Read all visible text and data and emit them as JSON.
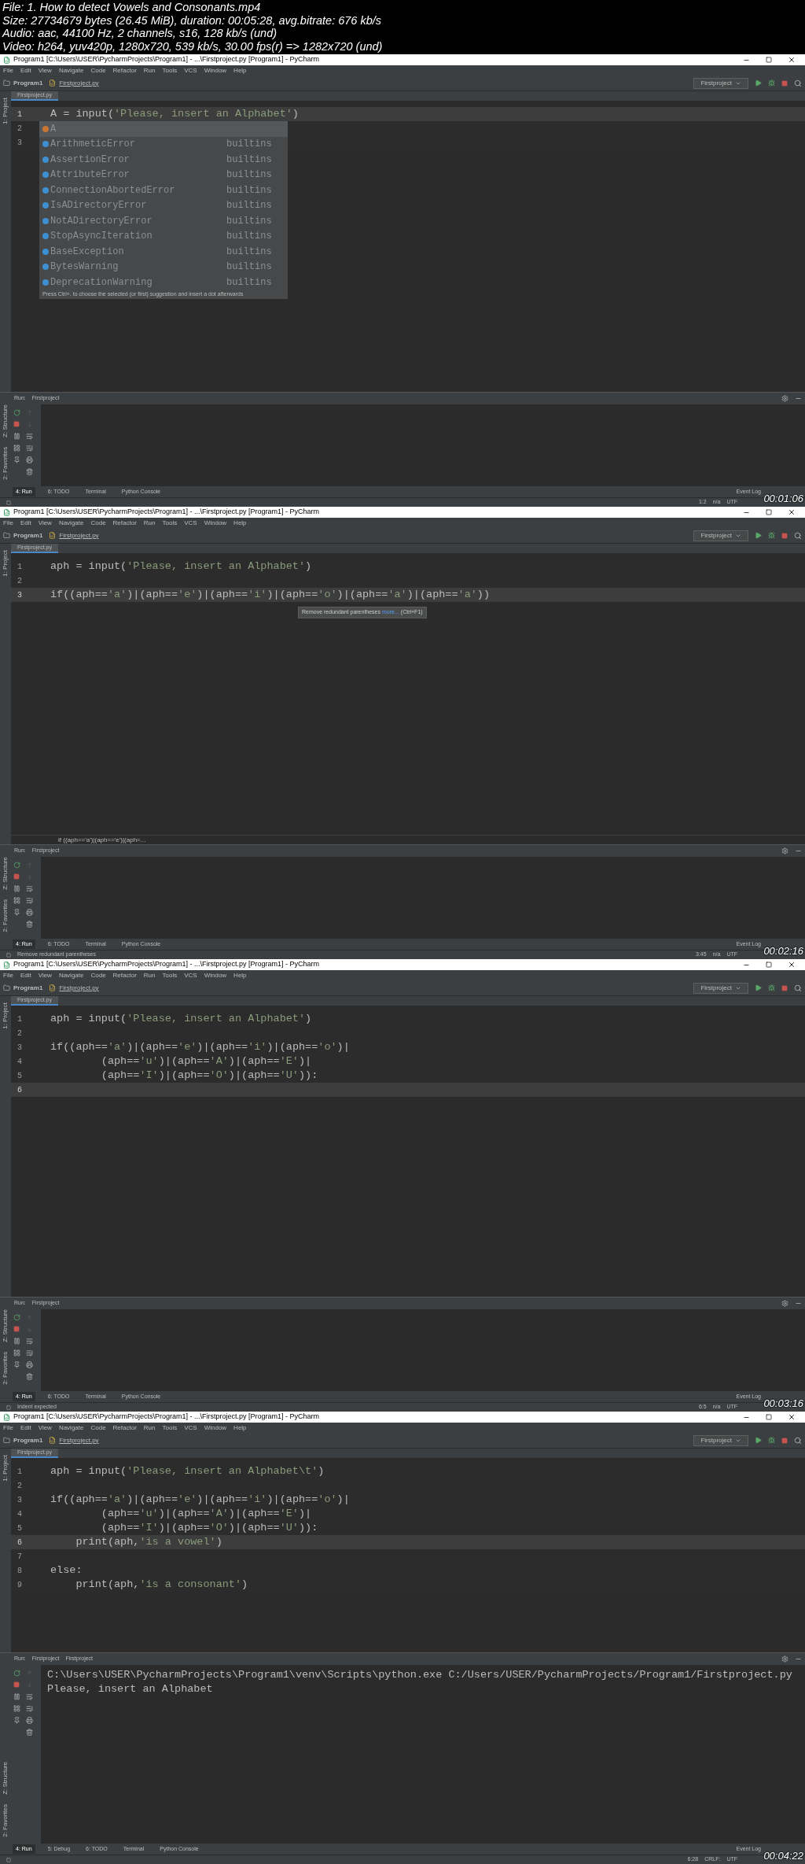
{
  "video_info": [
    "File: 1. How to detect Vowels and Consonants.mp4",
    "Size: 27734679 bytes (26.45 MiB), duration: 00:05:28, avg.bitrate: 676 kb/s",
    "Audio: aac, 44100 Hz, 2 channels, s16, 128 kb/s (und)",
    "Video: h264, yuv420p, 1280x720, 539 kb/s, 30.00 fps(r) => 1282x720 (und)"
  ],
  "frames": [
    {
      "title": "Program1 [C:\\Users\\USER\\PycharmProjects\\Program1] - ...\\Firstproject.py [Program1] - PyCharm",
      "menu": [
        "File",
        "Edit",
        "View",
        "Navigate",
        "Code",
        "Refactor",
        "Run",
        "Tools",
        "VCS",
        "Window",
        "Help"
      ],
      "project": "Program1",
      "file_crumb": "Firstproject.py",
      "run_config": "Firstproject",
      "editor_tab": "Firstproject.py",
      "side_labels": [
        "1: Project"
      ],
      "code": [
        {
          "number": "1",
          "text": "A = input('Please, insert an Alphabet')",
          "current": true
        },
        {
          "number": "2",
          "current": false
        },
        {
          "number": "3",
          "current": false
        }
      ],
      "completion": {
        "items": [
          {
            "name": "A",
            "selected": true,
            "color": "#c57633"
          },
          {
            "name": "ArithmeticError",
            "source": "builtins",
            "selected": false,
            "color": "#3d8fd1"
          },
          {
            "name": "AssertionError",
            "source": "builtins",
            "selected": false,
            "color": "#3d8fd1"
          },
          {
            "name": "AttributeError",
            "source": "builtins",
            "selected": false,
            "color": "#3d8fd1"
          },
          {
            "name": "ConnectionAbortedError",
            "source": "builtins",
            "selected": false,
            "color": "#3d8fd1"
          },
          {
            "name": "IsADirectoryError",
            "source": "builtins",
            "selected": false,
            "color": "#3d8fd1"
          },
          {
            "name": "NotADirectoryError",
            "source": "builtins",
            "selected": false,
            "color": "#3d8fd1"
          },
          {
            "name": "StopAsyncIteration",
            "source": "builtins",
            "selected": false,
            "color": "#3d8fd1"
          },
          {
            "name": "BaseException",
            "source": "builtins",
            "selected": false,
            "color": "#3d8fd1"
          },
          {
            "name": "BytesWarning",
            "source": "builtins",
            "selected": false,
            "color": "#3d8fd1"
          },
          {
            "name": "DeprecationWarning",
            "source": "builtins",
            "selected": false,
            "color": "#3d8fd1"
          }
        ],
        "hint": "Press Ctrl+. to choose the selected (or first) suggestion and insert a dot afterwards"
      },
      "run_label": "Run:",
      "run_tabs": [
        "Firstproject"
      ],
      "run_side_labels": [
        "Z: Structure",
        "2: Favorites"
      ],
      "tool_tabs": [
        {
          "label": "4: Run",
          "selected": true
        },
        {
          "label": "6: TODO",
          "selected": false
        },
        {
          "label": "Terminal",
          "selected": false
        },
        {
          "label": "Python Console",
          "selected": false
        }
      ],
      "event_log": "Event Log",
      "status_items": [
        "1:2",
        "n/a",
        "UTF"
      ],
      "timestamp": "00:01:06"
    },
    {
      "title": "Program1 [C:\\Users\\USER\\PycharmProjects\\Program1] - ...\\Firstproject.py [Program1] - PyCharm",
      "menu": [
        "File",
        "Edit",
        "View",
        "Navigate",
        "Code",
        "Refactor",
        "Run",
        "Tools",
        "VCS",
        "Window",
        "Help"
      ],
      "project": "Program1",
      "file_crumb": "Firstproject.py",
      "run_config": "Firstproject",
      "editor_tab": "Firstproject.py",
      "side_labels": [
        "1: Project"
      ],
      "code": [
        {
          "number": "1",
          "text": "aph = input('Please, insert an Alphabet')",
          "current": false
        },
        {
          "number": "2",
          "current": false
        },
        {
          "number": "3",
          "text": "if((aph=='a')|(aph=='e')|(aph=='i')|(aph=='o')|(aph=='a')|(aph=='a'))",
          "current": true
        }
      ],
      "tooltip": {
        "text": "Remove redundant parentheses",
        "link": "more...",
        "shortcut": "(Ctrl+F1)"
      },
      "breadcrumb": "if ((aph=='a')|(aph=='e')|(aph=...",
      "run_label": "Run:",
      "run_tabs": [
        "Firstproject"
      ],
      "run_side_labels": [
        "Z: Structure",
        "2: Favorites"
      ],
      "tool_tabs": [
        {
          "label": "4: Run",
          "selected": true
        },
        {
          "label": "6: TODO",
          "selected": false
        },
        {
          "label": "Terminal",
          "selected": false
        },
        {
          "label": "Python Console",
          "selected": false
        }
      ],
      "event_log": "Event Log",
      "status_message": "Remove redundant parentheses",
      "status_items": [
        "3:45",
        "n/a",
        "UTF"
      ],
      "timestamp": "00:02:16"
    },
    {
      "title": "Program1 [C:\\Users\\USER\\PycharmProjects\\Program1] - ...\\Firstproject.py [Program1] - PyCharm",
      "menu": [
        "File",
        "Edit",
        "View",
        "Navigate",
        "Code",
        "Refactor",
        "Run",
        "Tools",
        "VCS",
        "Window",
        "Help"
      ],
      "project": "Program1",
      "file_crumb": "Firstproject.py",
      "run_config": "Firstproject",
      "editor_tab": "Firstproject.py",
      "side_labels": [
        "1: Project"
      ],
      "code": [
        {
          "number": "1",
          "text": "aph = input('Please, insert an Alphabet')",
          "current": false
        },
        {
          "number": "2",
          "current": false
        },
        {
          "number": "3",
          "text": "if((aph=='a')|(aph=='e')|(aph=='i')|(aph=='o')|",
          "current": false
        },
        {
          "number": "4",
          "text": "        (aph=='u')|(aph=='A')|(aph=='E')|",
          "current": false
        },
        {
          "number": "5",
          "text": "        (aph=='I')|(aph=='O')|(aph=='U')):",
          "current": false
        },
        {
          "number": "6",
          "current": true
        }
      ],
      "run_label": "Run:",
      "run_tabs": [
        "Firstproject"
      ],
      "run_side_labels": [
        "Z: Structure",
        "2: Favorites"
      ],
      "tool_tabs": [
        {
          "label": "4: Run",
          "selected": true
        },
        {
          "label": "6: TODO",
          "selected": false
        },
        {
          "label": "Terminal",
          "selected": false
        },
        {
          "label": "Python Console",
          "selected": false
        }
      ],
      "event_log": "Event Log",
      "status_message": "Indent expected",
      "status_items": [
        "6:5",
        "n/a",
        "UTF"
      ],
      "timestamp": "00:03:16"
    },
    {
      "title": "Program1 [C:\\Users\\USER\\PycharmProjects\\Program1] - ...\\Firstproject.py [Program1] - PyCharm",
      "menu": [
        "File",
        "Edit",
        "View",
        "Navigate",
        "Code",
        "Refactor",
        "Run",
        "Tools",
        "VCS",
        "Window",
        "Help"
      ],
      "project": "Program1",
      "file_crumb": "Firstproject.py",
      "run_config": "Firstproject",
      "editor_tab": "Firstproject.py",
      "side_labels": [
        "1: Project"
      ],
      "code": [
        {
          "number": "1",
          "text": "aph = input('Please, insert an Alphabet\\t')",
          "current": false
        },
        {
          "number": "2",
          "current": false
        },
        {
          "number": "3",
          "text": "if((aph=='a')|(aph=='e')|(aph=='i')|(aph=='o')|",
          "current": false
        },
        {
          "number": "4",
          "text": "        (aph=='u')|(aph=='A')|(aph=='E')|",
          "current": false
        },
        {
          "number": "5",
          "text": "        (aph=='I')|(aph=='O')|(aph=='U')):",
          "current": false
        },
        {
          "number": "6",
          "text": "    print(aph,'is a vowel')",
          "current": true
        },
        {
          "number": "7",
          "current": false
        },
        {
          "number": "8",
          "text": "else:",
          "current": false
        },
        {
          "number": "9",
          "text": "    print(aph,'is a consonant')",
          "current": false
        }
      ],
      "run_label": "Run:",
      "run_tabs": [
        "Firstproject",
        "Firstproject"
      ],
      "run_side_labels": [
        "Z: Structure",
        "2: Favorites"
      ],
      "console": [
        "C:\\Users\\USER\\PycharmProjects\\Program1\\venv\\Scripts\\python.exe C:/Users/USER/PycharmProjects/Program1/Firstproject.py",
        "Please, insert an Alphabet"
      ],
      "tool_tabs": [
        {
          "label": "4: Run",
          "selected": true
        },
        {
          "label": "5: Debug",
          "selected": false
        },
        {
          "label": "6: TODO",
          "selected": false
        },
        {
          "label": "Terminal",
          "selected": false
        },
        {
          "label": "Python Console",
          "selected": false
        }
      ],
      "event_log": "Event Log",
      "status_items": [
        "6:28",
        "CRLF:",
        "UTF"
      ],
      "timestamp": "00:04:22"
    }
  ]
}
